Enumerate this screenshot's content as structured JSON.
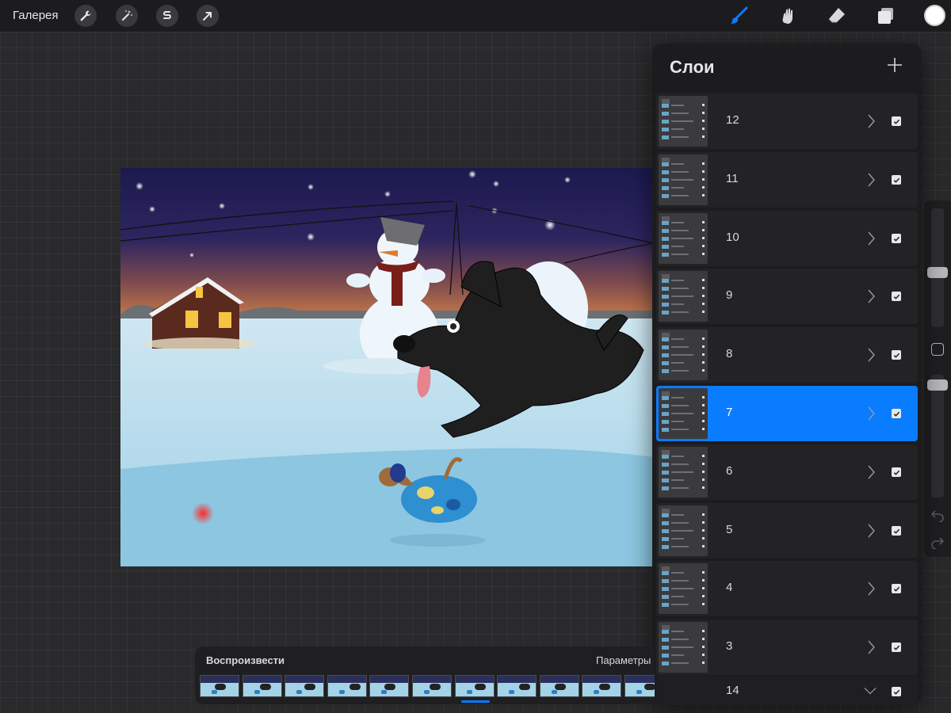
{
  "app": {
    "gallery_label": "Галерея"
  },
  "toolbar": {
    "left_tools": [
      "wrench-icon",
      "magic-wand-icon",
      "selection-s-icon",
      "transform-arrow-icon"
    ],
    "right_tools": [
      "brush-icon",
      "smudge-icon",
      "eraser-icon",
      "layers-icon"
    ],
    "active_tool": "brush",
    "accent_color": "#0a7cff",
    "current_color": "#ffffff"
  },
  "layers_panel": {
    "title": "Слои",
    "add_icon": "plus-icon",
    "selected_layer": "7",
    "layers": [
      {
        "name": "12",
        "visible": true
      },
      {
        "name": "11",
        "visible": true
      },
      {
        "name": "10",
        "visible": true
      },
      {
        "name": "9",
        "visible": true
      },
      {
        "name": "8",
        "visible": true
      },
      {
        "name": "7",
        "visible": true
      },
      {
        "name": "6",
        "visible": true
      },
      {
        "name": "5",
        "visible": true
      },
      {
        "name": "4",
        "visible": true
      },
      {
        "name": "3",
        "visible": true
      }
    ],
    "bottom_layer": {
      "name": "14",
      "visible": true
    }
  },
  "animation_assist": {
    "play_label": "Воспроизвести",
    "settings_label": "Параметры",
    "frame_count_visible": 11,
    "current_frame_index": 6
  }
}
